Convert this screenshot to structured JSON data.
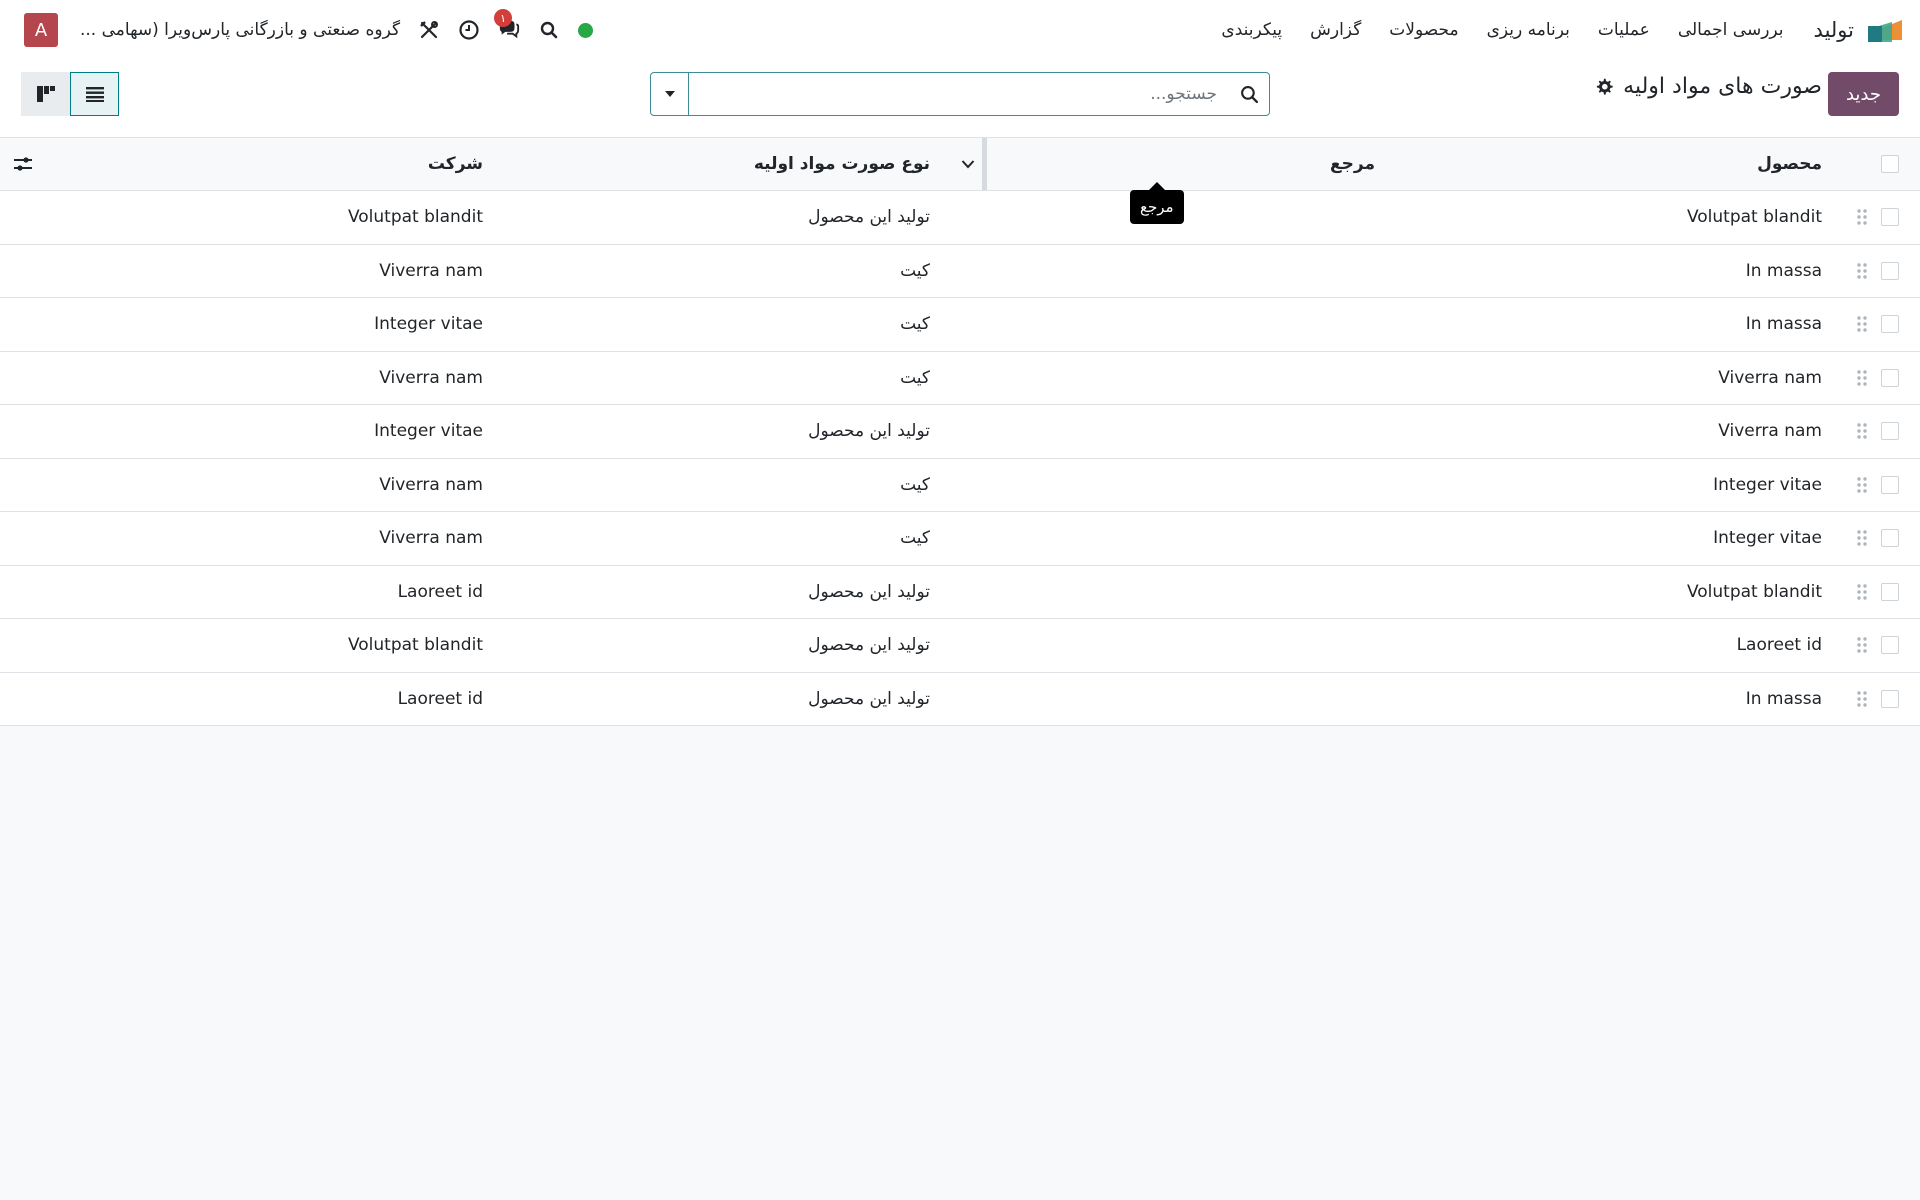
{
  "navbar": {
    "app_name": "تولید",
    "menu": [
      "بررسی اجمالی",
      "عملیات",
      "برنامه ریزی",
      "محصولات",
      "گزارش",
      "پیکربندی"
    ],
    "company": "گروه صنعتی و بازرگانی پارس‌ویرا (سهامی ...",
    "avatar_letter": "A",
    "chat_badge": "۱",
    "colors": {
      "avatar": "#b5464d",
      "status": "#28a745",
      "badge": "#d23f3a"
    }
  },
  "control": {
    "new_button": "جدید",
    "title": "صورت های مواد اولیه",
    "search_placeholder": "جستجو...",
    "accent": "#714b67"
  },
  "table": {
    "headers": {
      "product": "محصول",
      "reference": "مرجع",
      "type": "نوع صورت مواد اولیه",
      "company": "شرکت"
    },
    "rows": [
      {
        "product": "Volutpat blandit",
        "reference": "",
        "type": "تولید این محصول",
        "company": "Volutpat blandit"
      },
      {
        "product": "In massa",
        "reference": "",
        "type": "کیت",
        "company": "Viverra nam"
      },
      {
        "product": "In massa",
        "reference": "",
        "type": "کیت",
        "company": "Integer vitae"
      },
      {
        "product": "Viverra nam",
        "reference": "",
        "type": "کیت",
        "company": "Viverra nam"
      },
      {
        "product": "Viverra nam",
        "reference": "",
        "type": "تولید این محصول",
        "company": "Integer vitae"
      },
      {
        "product": "Integer vitae",
        "reference": "",
        "type": "کیت",
        "company": "Viverra nam"
      },
      {
        "product": "Integer vitae",
        "reference": "",
        "type": "کیت",
        "company": "Viverra nam"
      },
      {
        "product": "Volutpat blandit",
        "reference": "",
        "type": "تولید این محصول",
        "company": "Laoreet id"
      },
      {
        "product": "Laoreet id",
        "reference": "",
        "type": "تولید این محصول",
        "company": "Volutpat blandit"
      },
      {
        "product": "In massa",
        "reference": "",
        "type": "تولید این محصول",
        "company": "Laoreet id"
      }
    ]
  },
  "tooltip": {
    "text": "مرجع"
  }
}
